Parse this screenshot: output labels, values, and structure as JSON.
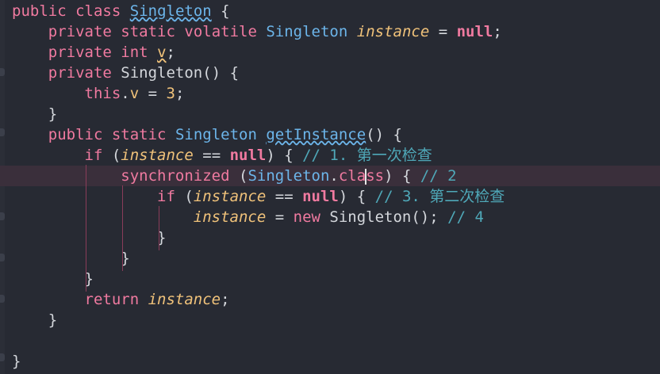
{
  "editor": {
    "language": "java",
    "cursor_line": 9,
    "lines": [
      [
        [
          "kw",
          "public"
        ],
        [
          "pc",
          " "
        ],
        [
          "kw",
          "class"
        ],
        [
          "pc",
          " "
        ],
        [
          "ty-und",
          "Singleton"
        ],
        [
          "pc",
          " {"
        ]
      ],
      [
        [
          "pc",
          "    "
        ],
        [
          "kw",
          "private"
        ],
        [
          "pc",
          " "
        ],
        [
          "kw",
          "static"
        ],
        [
          "pc",
          " "
        ],
        [
          "kw",
          "volatile"
        ],
        [
          "pc",
          " "
        ],
        [
          "ty",
          "Singleton"
        ],
        [
          "pc",
          " "
        ],
        [
          "it",
          "instance"
        ],
        [
          "pc",
          " = "
        ],
        [
          "kwb",
          "null"
        ],
        [
          "pc",
          ";"
        ]
      ],
      [
        [
          "pc",
          "    "
        ],
        [
          "kw",
          "private"
        ],
        [
          "pc",
          " "
        ],
        [
          "kw",
          "int"
        ],
        [
          "pc",
          " "
        ],
        [
          "nm-und",
          "v"
        ],
        [
          "pc",
          ";"
        ]
      ],
      [
        [
          "pc",
          "    "
        ],
        [
          "kw",
          "private"
        ],
        [
          "pc",
          " "
        ],
        [
          "id",
          "Singleton"
        ],
        [
          "pc",
          "() {"
        ]
      ],
      [
        [
          "pc",
          "        "
        ],
        [
          "kw",
          "this"
        ],
        [
          "pc",
          "."
        ],
        [
          "nm",
          "v"
        ],
        [
          "pc",
          " = "
        ],
        [
          "nm",
          "3"
        ],
        [
          "pc",
          ";"
        ]
      ],
      [
        [
          "pc",
          "    }"
        ]
      ],
      [
        [
          "pc",
          "    "
        ],
        [
          "kw",
          "public"
        ],
        [
          "pc",
          " "
        ],
        [
          "kw",
          "static"
        ],
        [
          "pc",
          " "
        ],
        [
          "ty",
          "Singleton"
        ],
        [
          "pc",
          " "
        ],
        [
          "ty-und",
          "getInstance"
        ],
        [
          "pc",
          "() {"
        ]
      ],
      [
        [
          "pc",
          "        "
        ],
        [
          "kw",
          "if"
        ],
        [
          "pc",
          " ("
        ],
        [
          "it",
          "instance"
        ],
        [
          "pc",
          " == "
        ],
        [
          "kwb",
          "null"
        ],
        [
          "pc",
          ") { "
        ],
        [
          "cm",
          "// 1. 第一次检查"
        ]
      ],
      [
        [
          "pc",
          "            "
        ],
        [
          "kw",
          "synchronized"
        ],
        [
          "pc",
          " ("
        ],
        [
          "ty",
          "Singleton"
        ],
        [
          "pc",
          "."
        ],
        [
          "kw",
          "cla"
        ],
        [
          "caret",
          ""
        ],
        [
          "kw",
          "ss"
        ],
        [
          "pc",
          ") { "
        ],
        [
          "cm",
          "// 2"
        ]
      ],
      [
        [
          "pc",
          "                "
        ],
        [
          "kw",
          "if"
        ],
        [
          "pc",
          " ("
        ],
        [
          "it",
          "instance"
        ],
        [
          "pc",
          " == "
        ],
        [
          "kwb",
          "null"
        ],
        [
          "pc",
          ") { "
        ],
        [
          "cm",
          "// 3. 第二次检查"
        ]
      ],
      [
        [
          "pc",
          "                    "
        ],
        [
          "it",
          "instance"
        ],
        [
          "pc",
          " = "
        ],
        [
          "kw",
          "new"
        ],
        [
          "pc",
          " "
        ],
        [
          "id",
          "Singleton"
        ],
        [
          "pc",
          "(); "
        ],
        [
          "cm",
          "// 4"
        ]
      ],
      [
        [
          "pc",
          "                }"
        ]
      ],
      [
        [
          "pc",
          "            }"
        ]
      ],
      [
        [
          "pc",
          "        }"
        ]
      ],
      [
        [
          "pc",
          "        "
        ],
        [
          "kw",
          "return"
        ],
        [
          "pc",
          " "
        ],
        [
          "it",
          "instance"
        ],
        [
          "pc",
          ";"
        ]
      ],
      [
        [
          "pc",
          "    }"
        ]
      ],
      [
        [
          "pc",
          ""
        ]
      ],
      [
        [
          "pc",
          "}"
        ]
      ]
    ]
  }
}
